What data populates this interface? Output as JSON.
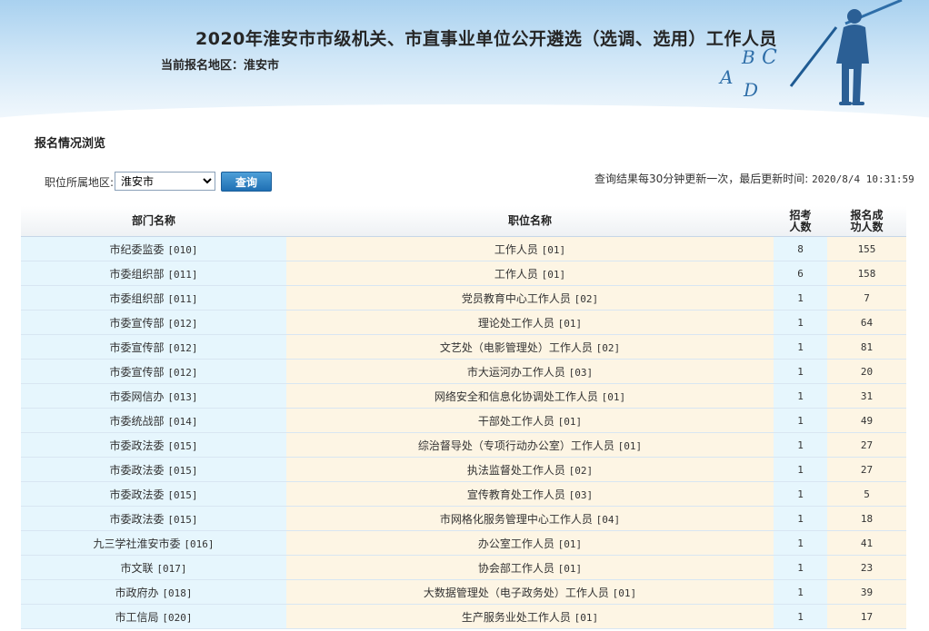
{
  "header": {
    "title": "2020年淮安市市级机关、市直事业单位公开遴选（选调、选用）工作人员",
    "current_region": "当前报名地区：淮安市"
  },
  "page": {
    "heading": "报名情况浏览"
  },
  "filter": {
    "label": "职位所属地区:",
    "selected": "淮安市",
    "button_label": "查询"
  },
  "update_note": {
    "text": "查询结果每30分钟更新一次，最后更新时间:",
    "time": "2020/8/4 10:31:59"
  },
  "table": {
    "headers": {
      "dept": "部门名称",
      "position": "职位名称",
      "quota_line1": "招考",
      "quota_line2": "人数",
      "applicants_line1": "报名成",
      "applicants_line2": "功人数"
    },
    "rows": [
      {
        "dept": "市纪委监委",
        "dept_code": "[010]",
        "position": "工作人员",
        "pos_code": "[01]",
        "quota": "8",
        "applicants": "155"
      },
      {
        "dept": "市委组织部",
        "dept_code": "[011]",
        "position": "工作人员",
        "pos_code": "[01]",
        "quota": "6",
        "applicants": "158"
      },
      {
        "dept": "市委组织部",
        "dept_code": "[011]",
        "position": "党员教育中心工作人员",
        "pos_code": "[02]",
        "quota": "1",
        "applicants": "7"
      },
      {
        "dept": "市委宣传部",
        "dept_code": "[012]",
        "position": "理论处工作人员",
        "pos_code": "[01]",
        "quota": "1",
        "applicants": "64"
      },
      {
        "dept": "市委宣传部",
        "dept_code": "[012]",
        "position": "文艺处（电影管理处）工作人员",
        "pos_code": "[02]",
        "quota": "1",
        "applicants": "81"
      },
      {
        "dept": "市委宣传部",
        "dept_code": "[012]",
        "position": "市大运河办工作人员",
        "pos_code": "[03]",
        "quota": "1",
        "applicants": "20"
      },
      {
        "dept": "市委网信办",
        "dept_code": "[013]",
        "position": "网络安全和信息化协调处工作人员",
        "pos_code": "[01]",
        "quota": "1",
        "applicants": "31"
      },
      {
        "dept": "市委统战部",
        "dept_code": "[014]",
        "position": "干部处工作人员",
        "pos_code": "[01]",
        "quota": "1",
        "applicants": "49"
      },
      {
        "dept": "市委政法委",
        "dept_code": "[015]",
        "position": "综治督导处（专项行动办公室）工作人员",
        "pos_code": "[01]",
        "quota": "1",
        "applicants": "27"
      },
      {
        "dept": "市委政法委",
        "dept_code": "[015]",
        "position": "执法监督处工作人员",
        "pos_code": "[02]",
        "quota": "1",
        "applicants": "27"
      },
      {
        "dept": "市委政法委",
        "dept_code": "[015]",
        "position": "宣传教育处工作人员",
        "pos_code": "[03]",
        "quota": "1",
        "applicants": "5"
      },
      {
        "dept": "市委政法委",
        "dept_code": "[015]",
        "position": "市网格化服务管理中心工作人员",
        "pos_code": "[04]",
        "quota": "1",
        "applicants": "18"
      },
      {
        "dept": "九三学社淮安市委",
        "dept_code": "[016]",
        "position": "办公室工作人员",
        "pos_code": "[01]",
        "quota": "1",
        "applicants": "41"
      },
      {
        "dept": "市文联",
        "dept_code": "[017]",
        "position": "协会部工作人员",
        "pos_code": "[01]",
        "quota": "1",
        "applicants": "23"
      },
      {
        "dept": "市政府办",
        "dept_code": "[018]",
        "position": "大数据管理处（电子政务处）工作人员",
        "pos_code": "[01]",
        "quota": "1",
        "applicants": "39"
      },
      {
        "dept": "市工信局",
        "dept_code": "[020]",
        "position": "生产服务业处工作人员",
        "pos_code": "[01]",
        "quota": "1",
        "applicants": "17"
      }
    ]
  },
  "logo": {
    "letters": [
      "A",
      "B",
      "C",
      "D"
    ]
  },
  "colors": {
    "dept_column": "#e6f6fd",
    "position_column": "#fdf5e4",
    "button": "#2a7fc4"
  }
}
